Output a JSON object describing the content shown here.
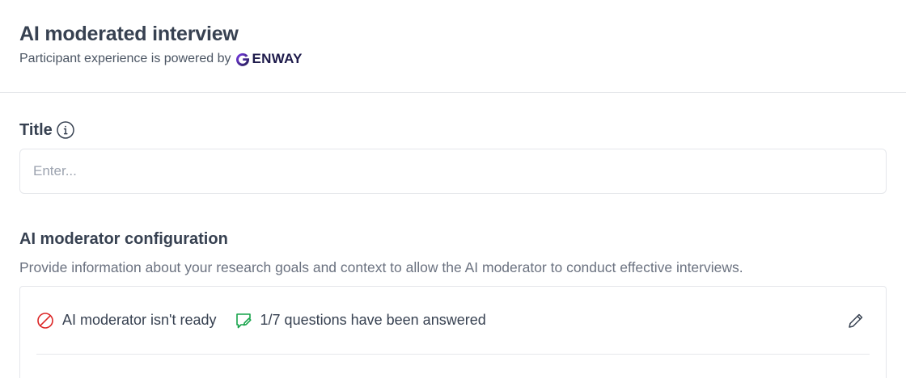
{
  "header": {
    "title": "AI moderated interview",
    "powered_by": "Participant experience is powered by",
    "brand_name": "ENWAY",
    "brand_full": "GENWAY"
  },
  "title_field": {
    "label": "Title",
    "placeholder": "Enter...",
    "value": ""
  },
  "ai_config": {
    "heading": "AI moderator configuration",
    "description": "Provide information about your research goals and context to allow the AI moderator to conduct effective interviews.",
    "status": {
      "ready_text": "AI moderator isn't ready",
      "progress_text": "1/7 questions have been answered"
    }
  },
  "icons": {
    "info": "info-icon",
    "not_ready": "prohibited-icon",
    "questions": "chat-edit-icon",
    "edit": "pencil-icon"
  },
  "colors": {
    "not_ready": "#dc2626",
    "questions": "#16a34a",
    "brand": "#1e1b4b",
    "brand_accent": "#6d28d9"
  }
}
